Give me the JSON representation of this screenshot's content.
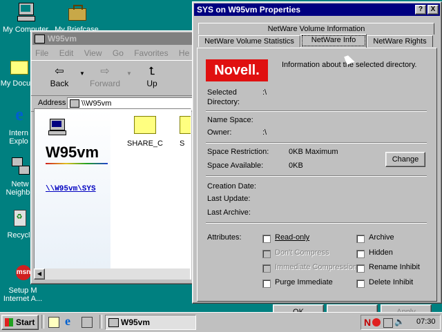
{
  "desktop": {
    "icons": [
      {
        "label": "My Computer",
        "icon": "computer-icon"
      },
      {
        "label": "My Briefcase",
        "icon": "briefcase-icon"
      },
      {
        "label": "My Docu...",
        "icon": "folder-icon"
      },
      {
        "label": "Intern",
        "label2": "Explo",
        "icon": "internet-explorer-icon"
      },
      {
        "label": "Netw",
        "label2": "Neighbo",
        "icon": "network-icon"
      },
      {
        "label": "Recycl",
        "icon": "recycle-bin-icon"
      },
      {
        "label": "Setup M",
        "label2": "Internet A...",
        "icon": "msn-icon"
      }
    ]
  },
  "explorer": {
    "title": "W95vm",
    "menu": [
      "File",
      "Edit",
      "View",
      "Go",
      "Favorites",
      "He"
    ],
    "toolbar": {
      "back": "Back",
      "forward": "Forward",
      "up": "Up"
    },
    "address_label": "Address",
    "address_value": "\\\\W95vm",
    "banner_title": "W95vm",
    "link": "\\\\W95vm\\SYS",
    "folders": [
      "SHARE_C",
      "S"
    ]
  },
  "dialog": {
    "title": "SYS on W95vm Properties",
    "help_btn": "?",
    "close_btn": "X",
    "tabs_row1": [
      "NetWare Volume Information"
    ],
    "tabs_row2": [
      "NetWare Volume Statistics",
      "NetWare Info",
      "NetWare Rights"
    ],
    "logo": "Novell.",
    "intro": "Information about the selected directory.",
    "fields": {
      "selected_directory_label1": "Selected",
      "selected_directory_label2": "Directory:",
      "selected_directory_value": ":\\",
      "name_space_label": "Name Space:",
      "owner_label": "Owner:",
      "owner_value": ":\\",
      "space_restriction_label": "Space Restriction:",
      "space_restriction_value": "0KB Maximum",
      "space_available_label": "Space Available:",
      "space_available_value": "0KB",
      "change_btn": "Change",
      "creation_date_label": "Creation Date:",
      "last_update_label": "Last Update:",
      "last_archive_label": "Last Archive:",
      "attributes_label": "Attributes:"
    },
    "attributes_left": [
      {
        "label": "Read-only",
        "disabled": false
      },
      {
        "label": "Don't Compress",
        "disabled": true
      },
      {
        "label": "Immediate Compression",
        "disabled": true
      },
      {
        "label": "Purge Immediate",
        "disabled": false
      }
    ],
    "attributes_right": [
      {
        "label": "Archive",
        "disabled": false
      },
      {
        "label": "Hidden",
        "disabled": false
      },
      {
        "label": "Rename Inhibit",
        "disabled": false
      },
      {
        "label": "Delete Inhibit",
        "disabled": false
      }
    ],
    "ok_btn": "OK",
    "apply_btn": "Apply"
  },
  "taskbar": {
    "start": "Start",
    "task": "W95vm",
    "tray_n": "N",
    "clock": "07:30"
  }
}
